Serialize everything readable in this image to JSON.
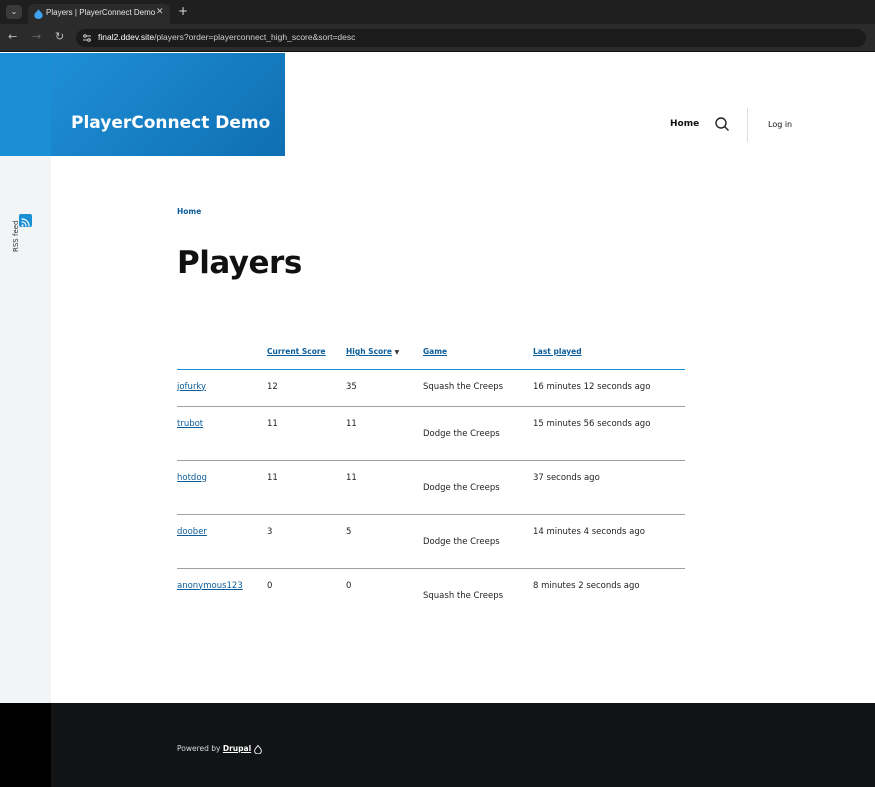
{
  "browser": {
    "tab_title": "Players | PlayerConnect Demo",
    "tab_close": "✕",
    "new_tab": "+",
    "url_host": "final2.ddev.site",
    "url_path": "/players?order=playerconnect_high_score&sort=desc",
    "back": "←",
    "forward": "→",
    "reload": "↻",
    "menu": "⌄"
  },
  "header": {
    "site_name": "PlayerConnect Demo",
    "nav_home": "Home",
    "login": "Log in"
  },
  "sidebar": {
    "rss_label": "RSS feed"
  },
  "breadcrumb": "Home",
  "page_title": "Players",
  "table": {
    "columns": [
      "",
      "Current Score",
      "High Score",
      "Game",
      "Last played"
    ],
    "sort_indicator": "▼",
    "rows": [
      {
        "player": "jofurky",
        "current": "12",
        "high": "35",
        "game": "Squash the Creeps",
        "last": "16 minutes 12 seconds ago"
      },
      {
        "player": "trubot",
        "current": "11",
        "high": "11",
        "game": "Dodge the Creeps",
        "last": "15 minutes 56 seconds ago"
      },
      {
        "player": "hotdog",
        "current": "11",
        "high": "11",
        "game": "Dodge the Creeps",
        "last": "37 seconds ago"
      },
      {
        "player": "doober",
        "current": "3",
        "high": "5",
        "game": "Dodge the Creeps",
        "last": "14 minutes 4 seconds ago"
      },
      {
        "player": "anonymous123",
        "current": "0",
        "high": "0",
        "game": "Squash the Creeps",
        "last": "8 minutes 2 seconds ago"
      }
    ]
  },
  "footer": {
    "powered_by": "Powered by",
    "drupal": "Drupal"
  },
  "colors": {
    "brand_blue": "#1a8fd6",
    "link": "#0b5d9c"
  }
}
